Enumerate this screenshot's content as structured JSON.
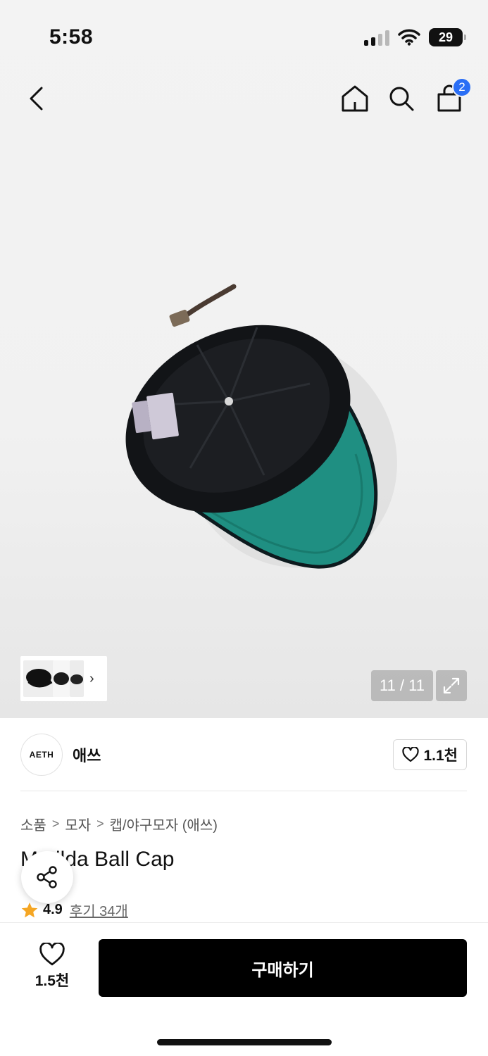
{
  "status_bar": {
    "time": "5:58",
    "battery": "29",
    "icons": [
      "signal-icon",
      "wifi-icon",
      "battery-icon"
    ]
  },
  "nav": {
    "cart_count": "2",
    "icons": [
      "back-icon",
      "home-icon",
      "search-icon",
      "cart-icon"
    ]
  },
  "gallery": {
    "counter": "11 / 11",
    "thumbnail_arrow": "›",
    "expand_icon": "expand-icon"
  },
  "brand": {
    "logo_text": "AETH",
    "name": "애쓰",
    "likes": "1.1천"
  },
  "breadcrumb": {
    "items": [
      "소품",
      "모자",
      "캡/야구모자 (애쓰)"
    ]
  },
  "product": {
    "title": "Matilda Ball Cap",
    "rating": "4.9",
    "reviews": "후기 34개"
  },
  "bottom": {
    "wish_count": "1.5천",
    "buy_label": "구매하기"
  },
  "colors": {
    "accent": "#2a6ef5",
    "button": "#000000",
    "star": "#f5a623",
    "cap_body": "#121417",
    "cap_brim": "#1f8f82"
  }
}
